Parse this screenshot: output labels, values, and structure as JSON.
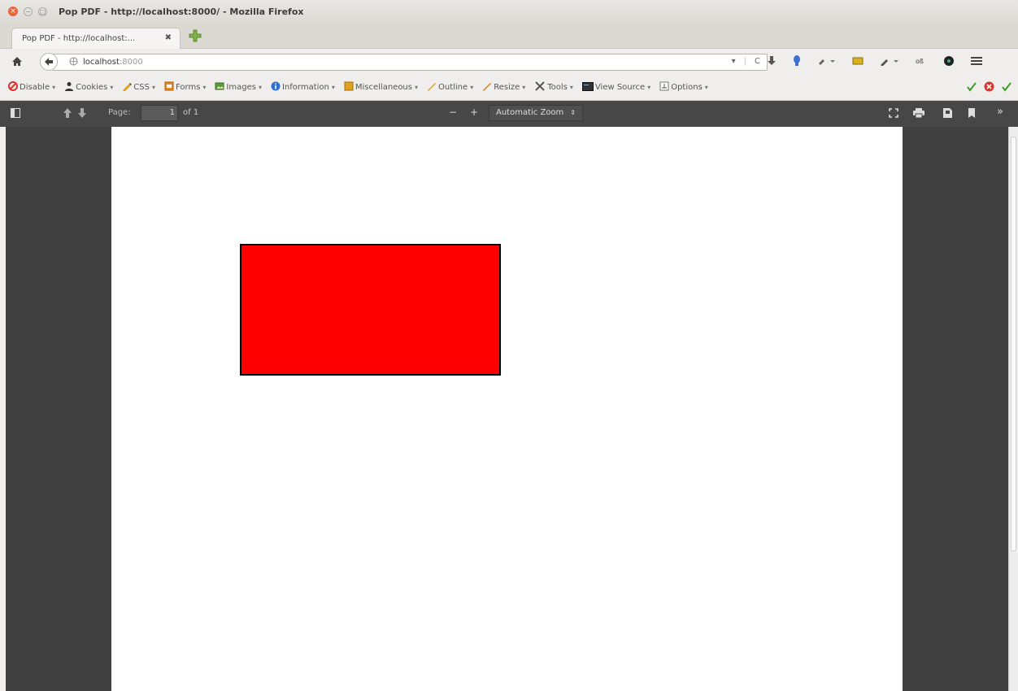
{
  "window": {
    "title": "Pop PDF - http://localhost:8000/ - Mozilla Firefox",
    "close": "×",
    "min": "−",
    "max": "□"
  },
  "tab": {
    "label": "Pop PDF - http://localhost:...",
    "close": "✖"
  },
  "nav": {
    "url_host": "localhost",
    "url_port": ":8000",
    "url_dropdown": "▾",
    "reload": "C"
  },
  "devtoolbar": {
    "items": [
      {
        "label": "Disable",
        "icon": "disable-icon"
      },
      {
        "label": "Cookies",
        "icon": "cookies-icon"
      },
      {
        "label": "CSS",
        "icon": "css-icon"
      },
      {
        "label": "Forms",
        "icon": "forms-icon"
      },
      {
        "label": "Images",
        "icon": "images-icon"
      },
      {
        "label": "Information",
        "icon": "information-icon"
      },
      {
        "label": "Miscellaneous",
        "icon": "miscellaneous-icon"
      },
      {
        "label": "Outline",
        "icon": "outline-icon"
      },
      {
        "label": "Resize",
        "icon": "resize-icon"
      },
      {
        "label": "Tools",
        "icon": "tools-icon"
      },
      {
        "label": "View Source",
        "icon": "view-source-icon"
      },
      {
        "label": "Options",
        "icon": "options-icon"
      }
    ],
    "arrow": "▾"
  },
  "pdf": {
    "page_label": "Page:",
    "page_value": "1",
    "page_of": "of 1",
    "zoom_minus": "−",
    "zoom_plus": "+",
    "zoom_label": "Automatic Zoom",
    "zoom_caret": "⇕",
    "more": "»"
  },
  "colors": {
    "rect_fill": "#ff0000",
    "pdf_toolbar": "#474747",
    "viewer_bg": "#404040"
  }
}
